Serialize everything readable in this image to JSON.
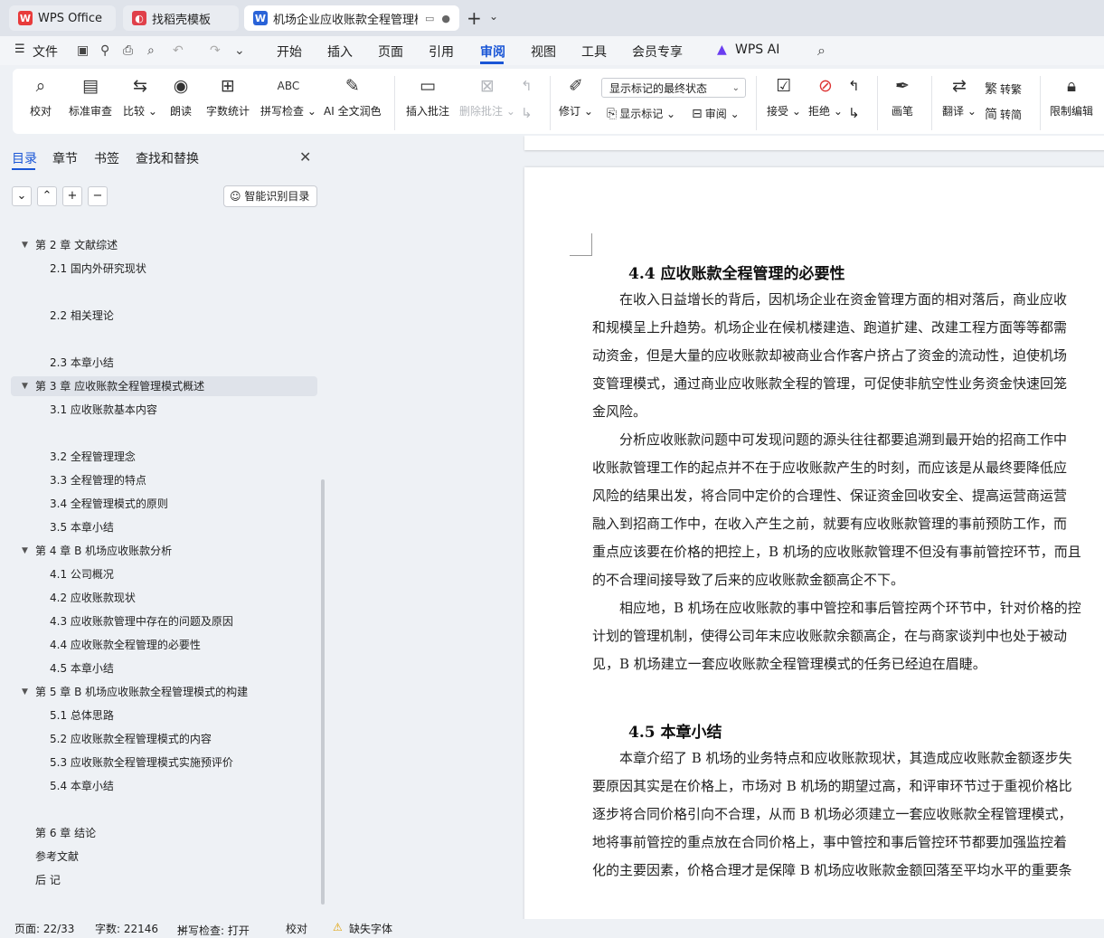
{
  "tabs": [
    {
      "label": "WPS Office",
      "icon": "wps-logo-icon",
      "color": "#e83b3b"
    },
    {
      "label": "找稻壳模板",
      "icon": "docer-logo-icon",
      "color": "#e0404a"
    },
    {
      "label": "机场企业应收账款全程管理模",
      "icon": "writer-doc-icon",
      "color": "#2a63d8"
    }
  ],
  "menu": {
    "file": "文件",
    "items": [
      "开始",
      "插入",
      "页面",
      "引用",
      "审阅",
      "视图",
      "工具",
      "会员专享",
      "WPS AI"
    ],
    "active": "审阅"
  },
  "ribbon": {
    "buttons": [
      {
        "name": "proofread",
        "label": "校对",
        "icon": "proofread-icon"
      },
      {
        "name": "standard-review",
        "label": "标准审查",
        "icon": "standard-review-icon"
      },
      {
        "name": "compare",
        "label": "比较",
        "icon": "compare-icon"
      },
      {
        "name": "read-aloud",
        "label": "朗读",
        "icon": "read-aloud-icon"
      },
      {
        "name": "word-count",
        "label": "字数统计",
        "icon": "word-count-icon"
      },
      {
        "name": "spell-check",
        "label": "拼写检查",
        "icon": "spell-check-icon"
      },
      {
        "name": "ai-polish",
        "label": "AI 全文润色",
        "icon": "ai-polish-icon"
      },
      {
        "name": "insert-comment",
        "label": "插入批注",
        "icon": "insert-comment-icon"
      },
      {
        "name": "delete-comment",
        "label": "删除批注",
        "icon": "delete-comment-icon"
      },
      {
        "name": "track-changes",
        "label": "修订",
        "icon": "track-changes-icon"
      },
      {
        "name": "accept",
        "label": "接受",
        "icon": "accept-icon"
      },
      {
        "name": "reject",
        "label": "拒绝",
        "icon": "reject-icon"
      },
      {
        "name": "pen",
        "label": "画笔",
        "icon": "pen-icon"
      },
      {
        "name": "translate",
        "label": "翻译",
        "icon": "translate-icon"
      },
      {
        "name": "restrict-edit",
        "label": "限制编辑",
        "icon": "restrict-edit-icon"
      }
    ],
    "markup_dropdown": "显示标记的最终状态",
    "show_markup": "显示标记",
    "review_pane": "审阅",
    "to_traditional": "转繁",
    "to_simplified": "转简"
  },
  "nav": {
    "tabs": [
      "目录",
      "章节",
      "书签",
      "查找和替换"
    ],
    "active": "目录",
    "smart_toc": "智能识别目录",
    "toc": [
      {
        "label": "第 2 章  文献综述",
        "level": 1,
        "expanded": true
      },
      {
        "label": "2.1 国内外研究现状",
        "level": 2
      },
      {
        "label": "2.2 相关理论",
        "level": 2
      },
      {
        "label": "2.3 本章小结",
        "level": 2
      },
      {
        "label": "第 3 章  应收账款全程管理模式概述",
        "level": 1,
        "expanded": true,
        "selected": true
      },
      {
        "label": "3.1 应收账款基本内容",
        "level": 2
      },
      {
        "label": "3.2 全程管理理念",
        "level": 2
      },
      {
        "label": "3.3 全程管理的特点",
        "level": 2
      },
      {
        "label": "3.4 全程管理模式的原则",
        "level": 2
      },
      {
        "label": "3.5 本章小结",
        "level": 2
      },
      {
        "label": "第 4 章  B 机场应收账款分析",
        "level": 1,
        "expanded": true
      },
      {
        "label": "4.1  公司概况",
        "level": 2
      },
      {
        "label": "4.2  应收账款现状",
        "level": 2
      },
      {
        "label": "4.3  应收账款管理中存在的问题及原因",
        "level": 2
      },
      {
        "label": "4.4  应收账款全程管理的必要性",
        "level": 2
      },
      {
        "label": "4.5  本章小结",
        "level": 2
      },
      {
        "label": "第 5 章 B 机场应收账款全程管理模式的构建",
        "level": 1,
        "expanded": true
      },
      {
        "label": "5.1  总体思路",
        "level": 2
      },
      {
        "label": "5.2  应收账款全程管理模式的内容",
        "level": 2
      },
      {
        "label": "5.3  应收账款全程管理模式实施预评价",
        "level": 2
      },
      {
        "label": "5.4  本章小结",
        "level": 2
      },
      {
        "label": "第 6 章  结论",
        "level": 1
      },
      {
        "label": "参考文献",
        "level": 1
      },
      {
        "label": "后  记",
        "level": 1
      }
    ]
  },
  "document": {
    "section1_title": "4.4  应收账款全程管理的必要性",
    "section1_lines": [
      "　　在收入日益增长的背后，因机场企业在资金管理方面的相对落后，商业应收",
      "和规模呈上升趋势。机场企业在候机楼建造、跑道扩建、改建工程方面等等都需",
      "动资金，但是大量的应收账款却被商业合作客户挤占了资金的流动性，迫使机场",
      "变管理模式，通过商业应收账款全程的管理，可促使非航空性业务资金快速回笼",
      "金风险。",
      "　　分析应收账款问题中可发现问题的源头往往都要追溯到最开始的招商工作中",
      "收账款管理工作的起点并不在于应收账款产生的时刻，而应该是从最终要降低应",
      "风险的结果出发，将合同中定价的合理性、保证资金回收安全、提高运营商运营",
      "融入到招商工作中，在收入产生之前，就要有应收账款管理的事前预防工作，而",
      "重点应该要在价格的把控上，B 机场的应收账款管理不但没有事前管控环节，而且",
      "的不合理间接导致了后来的应收账款金额高企不下。",
      "　　相应地，B 机场在应收账款的事中管控和事后管控两个环节中，针对价格的控",
      "计划的管理机制，使得公司年末应收账款余额高企，在与商家谈判中也处于被动",
      "见，B 机场建立一套应收账款全程管理模式的任务已经迫在眉睫。"
    ],
    "section2_title": "4.5  本章小结",
    "section2_lines": [
      "　　本章介绍了 B 机场的业务特点和应收账款现状，其造成应收账款金额逐步失",
      "要原因其实是在价格上，市场对 B 机场的期望过高，和评审环节过于重视价格比",
      "逐步将合同价格引向不合理，从而 B 机场必须建立一套应收账款全程管理模式，",
      "地将事前管控的重点放在合同价格上，事中管控和事后管控环节都要加强监控着",
      "化的主要因素，价格合理才是保障 B 机场应收账款金额回落至平均水平的重要条"
    ]
  },
  "status": {
    "page": "页面: 22/33",
    "words": "字数: 22146",
    "spell": "拼写检查: 打开",
    "proof": "校对",
    "missing_font": "缺失字体"
  },
  "colors": {
    "accent": "#1a56d6",
    "panel_bg": "#eef1f5",
    "tabbar_bg": "#dfe3ea"
  }
}
